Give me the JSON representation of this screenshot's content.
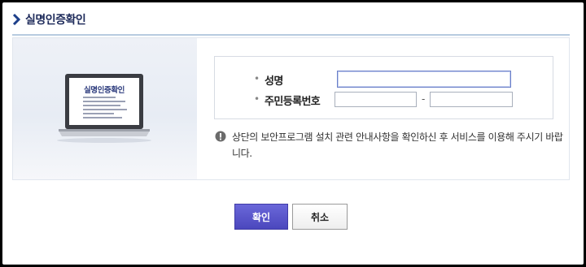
{
  "header": {
    "title": "실명인증확인"
  },
  "illustration": {
    "screen_title": "실명인증확인"
  },
  "form": {
    "name_label": "성명",
    "name_value": "",
    "rrn_label": "주민등록번호",
    "rrn_front_value": "",
    "rrn_back_value": "",
    "rrn_separator": "-",
    "bullet": "•"
  },
  "notice": {
    "icon": "exclamation-circle-icon",
    "text": "상단의 보안프로그램 설치 관련 안내사항을 확인하신 후 서비스를 이용해 주시기 바랍니다."
  },
  "buttons": {
    "confirm": "확인",
    "cancel": "취소"
  },
  "colors": {
    "confirm_bg": "#5653c8",
    "header_rule": "#b7cbe0",
    "title": "#1d2a5a"
  }
}
